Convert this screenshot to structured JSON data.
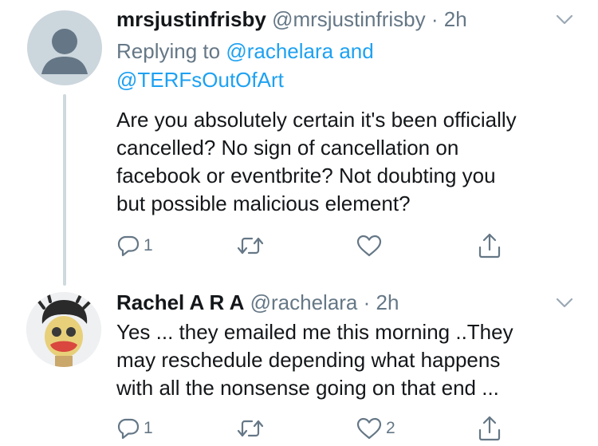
{
  "tweets": [
    {
      "name": "mrsjustinfrisby",
      "handle": "@mrsjustinfrisby",
      "separator": "·",
      "time": "2h",
      "replying_prefix": "Replying to",
      "reply_mentions": [
        "@rachelara",
        "and",
        "@TERFsOutOfArt"
      ],
      "body_lines": [
        "Are you absolutely certain it's been officially",
        "cancelled? No sign of cancellation on",
        "facebook or eventbrite?  Not doubting you",
        "but possible malicious element?"
      ],
      "reply_count": "1",
      "retweet_count": "",
      "like_count": "",
      "avatar_icon": "default-profile-icon"
    },
    {
      "name": "Rachel A R A",
      "handle": "@rachelara",
      "separator": "·",
      "time": "2h",
      "body_lines": [
        "Yes ... they emailed me this morning ..They",
        "may reschedule depending what happens",
        "with all the nonsense going on that end ..."
      ],
      "reply_count": "1",
      "retweet_count": "",
      "like_count": "2",
      "avatar_icon": "profile-photo"
    }
  ],
  "icons": {
    "reply": "reply-icon",
    "retweet": "retweet-icon",
    "like": "heart-icon",
    "share": "share-icon",
    "menu": "chevron-down-icon"
  },
  "colors": {
    "text": "#14171a",
    "muted": "#657786",
    "link": "#1da1f2",
    "thread_line": "#cfd9de"
  }
}
